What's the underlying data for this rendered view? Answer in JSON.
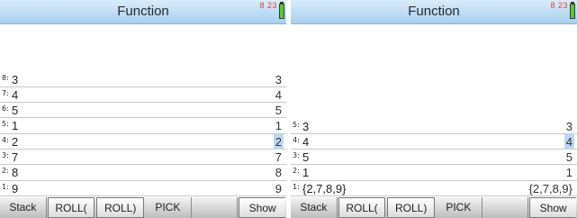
{
  "screens": [
    {
      "title": "Function",
      "clock": "8 23",
      "rows": [
        {
          "level": "8:",
          "left": "3",
          "right": "3",
          "selected": false
        },
        {
          "level": "7:",
          "left": "4",
          "right": "4",
          "selected": false
        },
        {
          "level": "6:",
          "left": "5",
          "right": "5",
          "selected": false
        },
        {
          "level": "5:",
          "left": "1",
          "right": "1",
          "selected": false
        },
        {
          "level": "4:",
          "left": "2",
          "right": "2",
          "selected": true
        },
        {
          "level": "3:",
          "left": "7",
          "right": "7",
          "selected": false
        },
        {
          "level": "2:",
          "left": "8",
          "right": "8",
          "selected": false
        },
        {
          "level": "1:",
          "left": "9",
          "right": "9",
          "selected": false
        }
      ],
      "menu": [
        "Stack",
        "ROLL(",
        "ROLL)",
        "PICK",
        "",
        "Show"
      ]
    },
    {
      "title": "Function",
      "clock": "8 23",
      "rows": [
        {
          "level": "5:",
          "left": "3",
          "right": "3",
          "selected": false
        },
        {
          "level": "4:",
          "left": "4",
          "right": "4",
          "selected": true
        },
        {
          "level": "3:",
          "left": "5",
          "right": "5",
          "selected": false
        },
        {
          "level": "2:",
          "left": "1",
          "right": "1",
          "selected": false
        },
        {
          "level": "1:",
          "left": "{2,7,8,9}",
          "right": "{2,7,8,9}",
          "selected": false
        }
      ],
      "menu": [
        "Stack",
        "ROLL(",
        "ROLL)",
        "PICK",
        "",
        "Show"
      ]
    }
  ]
}
